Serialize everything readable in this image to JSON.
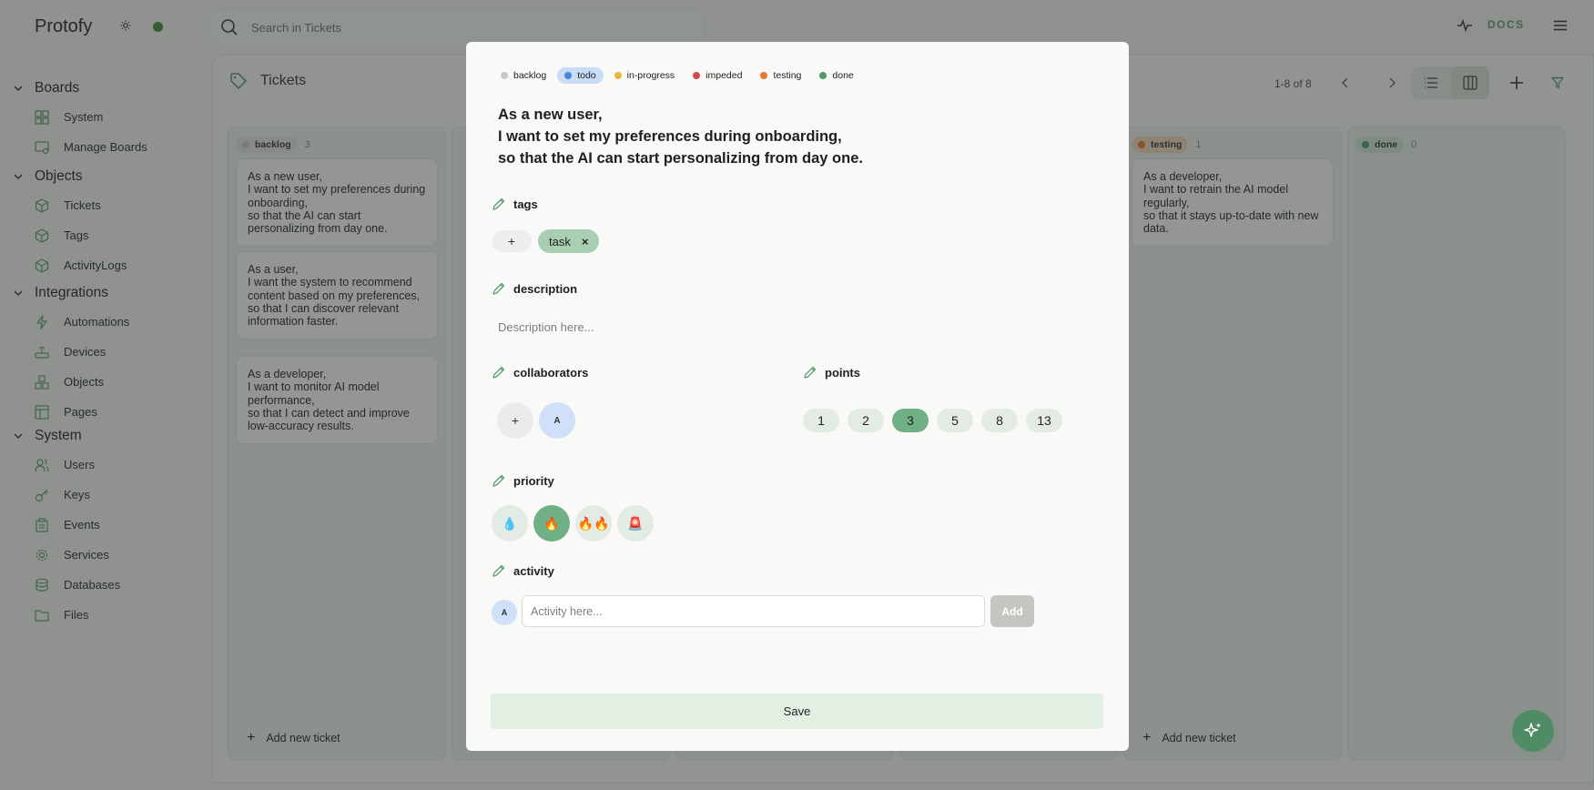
{
  "app": {
    "brand": "Protofy"
  },
  "search": {
    "placeholder": "Search in Tickets"
  },
  "topbar": {
    "docs_label": "DOCS"
  },
  "sidebar": {
    "sections": [
      {
        "title": "Boards",
        "items": [
          {
            "label": "System",
            "icon": "dashboard-icon"
          },
          {
            "label": "Manage Boards",
            "icon": "boards-manage-icon"
          }
        ]
      },
      {
        "title": "Objects",
        "items": [
          {
            "label": "Tickets",
            "icon": "box-icon"
          },
          {
            "label": "Tags",
            "icon": "box-icon"
          },
          {
            "label": "ActivityLogs",
            "icon": "box-icon"
          }
        ]
      },
      {
        "title": "Integrations",
        "items": [
          {
            "label": "Automations",
            "icon": "zap-icon"
          },
          {
            "label": "Devices",
            "icon": "router-icon"
          },
          {
            "label": "Objects",
            "icon": "boxes-icon"
          },
          {
            "label": "Pages",
            "icon": "layout-icon"
          }
        ]
      },
      {
        "title": "System",
        "items": [
          {
            "label": "Users",
            "icon": "users-icon"
          },
          {
            "label": "Keys",
            "icon": "key-icon"
          },
          {
            "label": "Events",
            "icon": "clipboard-icon"
          },
          {
            "label": "Services",
            "icon": "cog-icon"
          },
          {
            "label": "Databases",
            "icon": "database-icon"
          },
          {
            "label": "Files",
            "icon": "folder-icon"
          }
        ]
      }
    ]
  },
  "page": {
    "title": "Tickets",
    "pager": "1-8 of 8",
    "add_ticket_label": "Add new ticket"
  },
  "board": {
    "columns": [
      {
        "key": "backlog",
        "label": "backlog",
        "count": "3",
        "color": "#c9cac8",
        "cards": [
          "As a new user,\nI want to set my preferences during onboarding,\nso that the AI can start personalizing from day one.",
          "As a user,\nI want the system to recommend content based on my preferences,\nso that I can discover relevant information faster.",
          "As a developer,\nI want to monitor AI model performance,\nso that I can detect and improve low-accuracy results."
        ]
      },
      {
        "key": "testing",
        "label": "testing",
        "count": "1",
        "color": "#e47a2e",
        "cards": [
          "As a developer,\nI want to retrain the AI model regularly,\nso that it stays up-to-date with new data."
        ]
      },
      {
        "key": "done",
        "label": "done",
        "count": "0",
        "color": "#4f9a6a",
        "cards": []
      }
    ]
  },
  "modal": {
    "statuses": [
      {
        "label": "backlog",
        "color": "#c9cac8",
        "selected": false
      },
      {
        "label": "todo",
        "color": "#4a86d6",
        "selected": true
      },
      {
        "label": "in-progress",
        "color": "#e7b73a",
        "selected": false
      },
      {
        "label": "impeded",
        "color": "#d24b4b",
        "selected": false
      },
      {
        "label": "testing",
        "color": "#e47a2e",
        "selected": false
      },
      {
        "label": "done",
        "color": "#4f9a6a",
        "selected": false
      }
    ],
    "title": "As a new user,\nI want to set my preferences during onboarding,\nso that the AI can start personalizing from day one.",
    "labels": {
      "tags": "tags",
      "description": "description",
      "collaborators": "collaborators",
      "points": "points",
      "priority": "priority",
      "activity": "activity"
    },
    "add_symbol": "+",
    "tag": {
      "label": "task",
      "remove": "×"
    },
    "description_placeholder": "Description here...",
    "collaborator_initial": "A",
    "points": [
      {
        "value": "1",
        "selected": false
      },
      {
        "value": "2",
        "selected": false
      },
      {
        "value": "3",
        "selected": true
      },
      {
        "value": "5",
        "selected": false
      },
      {
        "value": "8",
        "selected": false
      },
      {
        "value": "13",
        "selected": false
      }
    ],
    "priorities": [
      {
        "emoji": "💧",
        "name": "low",
        "selected": false
      },
      {
        "emoji": "🔥",
        "name": "medium",
        "selected": true
      },
      {
        "emoji": "🔥🔥",
        "name": "high",
        "selected": false
      },
      {
        "emoji": "🚨",
        "name": "urgent",
        "selected": false
      }
    ],
    "activity_avatar": "A",
    "activity_placeholder": "Activity here...",
    "activity_add": "Add",
    "save": "Save"
  },
  "colors": {
    "accent": "#5c9e70",
    "status_ok": "#3f8f3d"
  }
}
